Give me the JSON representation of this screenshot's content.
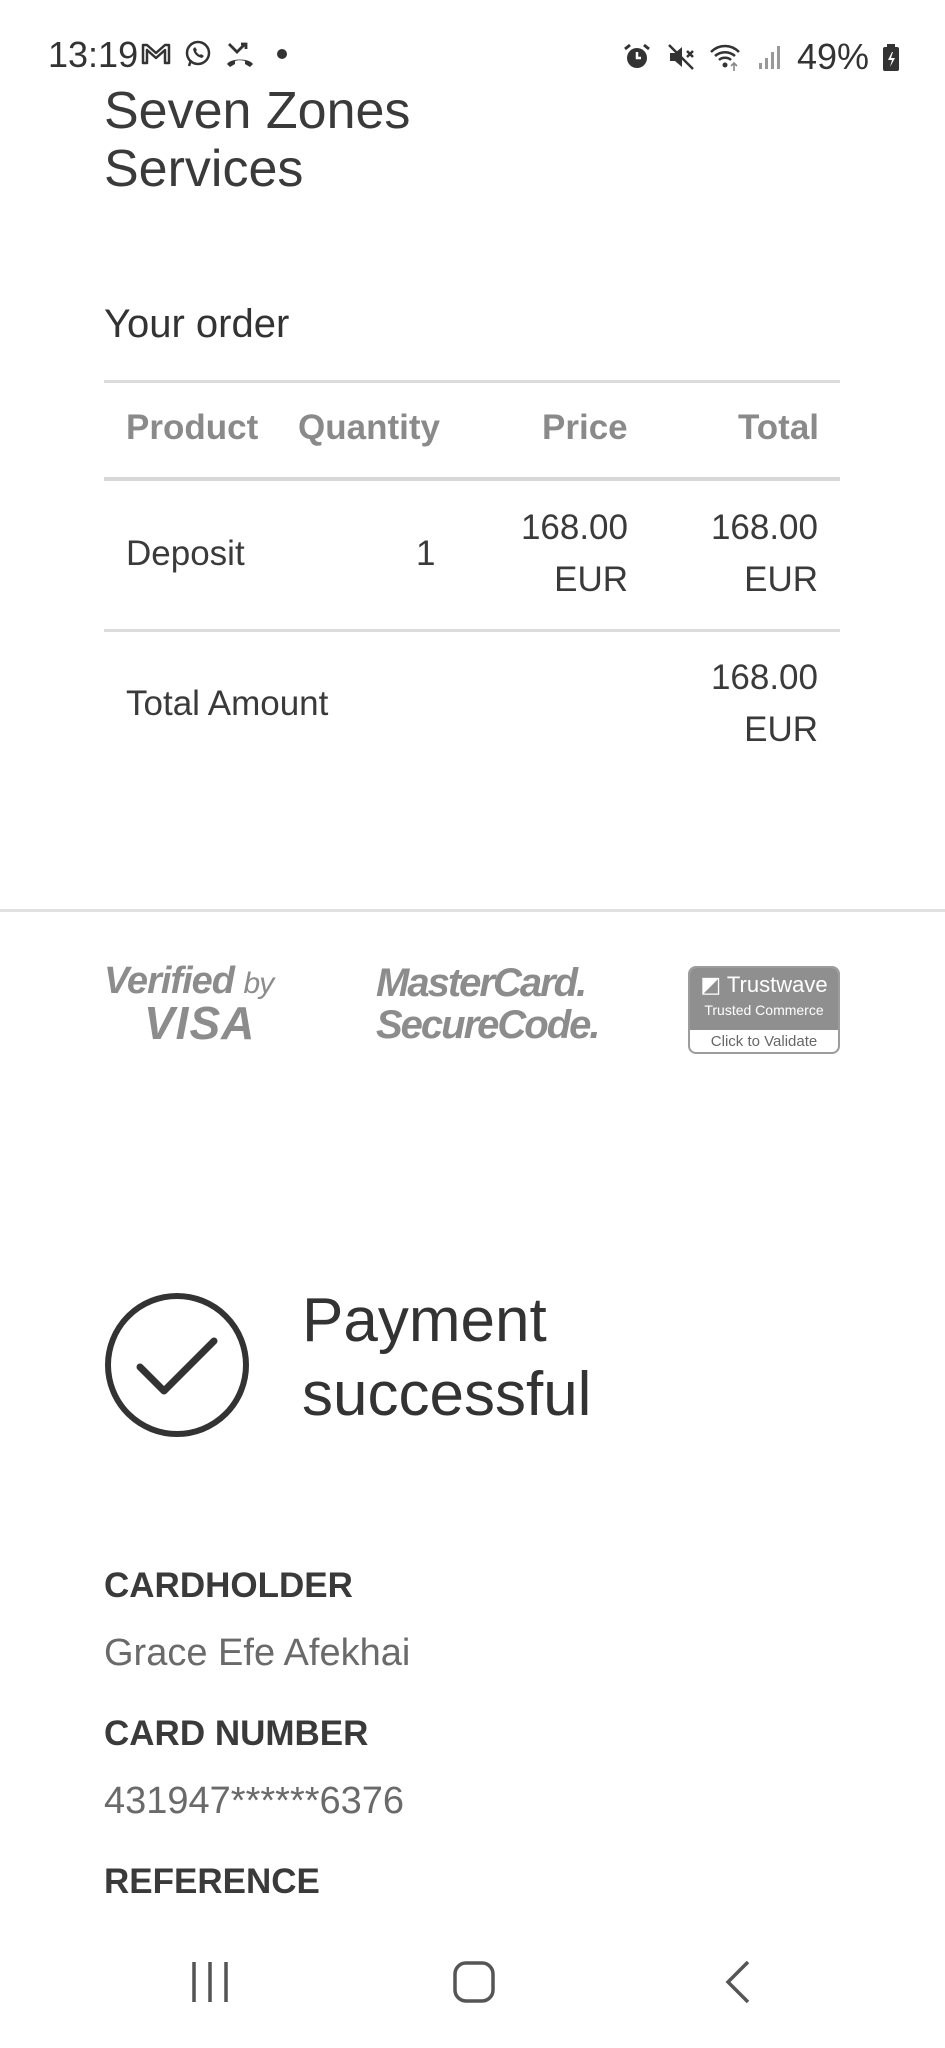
{
  "status_bar": {
    "time": "13:19",
    "battery": "49%",
    "left_icons": [
      "gmail-icon",
      "whatsapp-icon",
      "missed-call-icon",
      "dot-icon"
    ],
    "right_icons": [
      "alarm-icon",
      "mute-icon",
      "wifi-icon",
      "signal-icon",
      "battery-icon"
    ]
  },
  "merchant": {
    "line1": "Seven Zones",
    "line2": "Services"
  },
  "order": {
    "heading": "Your order",
    "columns": [
      "Product",
      "Quantity",
      "Price",
      "Total"
    ],
    "rows": [
      {
        "product": "Deposit",
        "quantity": "1",
        "price_amount": "168.00",
        "price_currency": "EUR",
        "total_amount": "168.00",
        "total_currency": "EUR"
      }
    ],
    "total_label": "Total Amount",
    "total_amount": "168.00",
    "total_currency": "EUR"
  },
  "badges": {
    "visa_line1": "Verified",
    "visa_by": "by",
    "visa_line2": "VISA",
    "mc_line1": "MasterCard.",
    "mc_line2": "SecureCode.",
    "trustwave_name": "Trustwave",
    "trustwave_sub": "Trusted Commerce",
    "trustwave_cta": "Click to Validate"
  },
  "result": {
    "line1": "Payment",
    "line2": "successful"
  },
  "details": {
    "cardholder_label": "CARDHOLDER",
    "cardholder_value": "Grace Efe Afekhai",
    "card_number_label": "CARD NUMBER",
    "card_number_value": "431947******6376",
    "reference_label": "REFERENCE"
  }
}
